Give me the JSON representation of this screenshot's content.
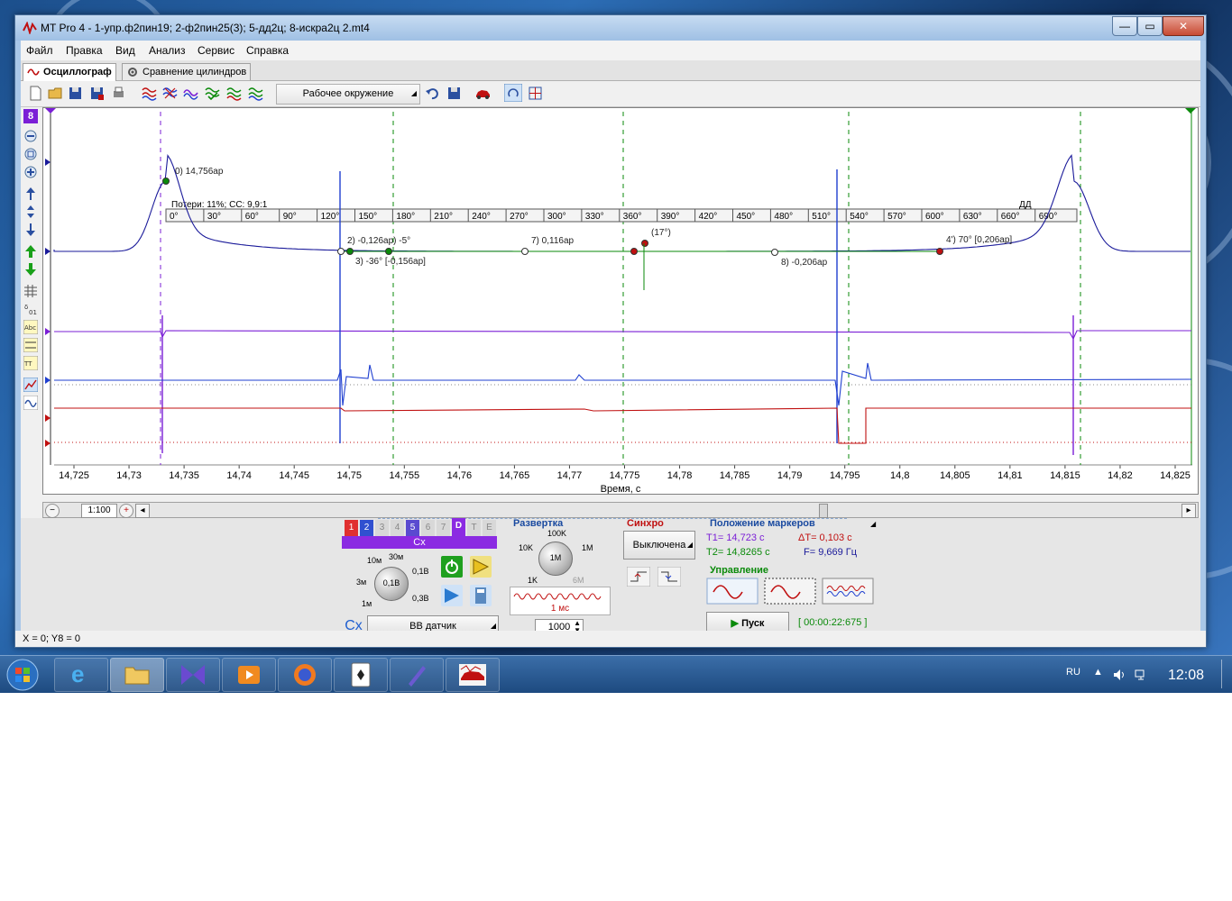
{
  "window": {
    "title": "MT Pro 4 - 1-упр.ф2пин19; 2-ф2пин25(3); 5-дд2ц; 8-искра2ц 2.mt4"
  },
  "menu": [
    "Файл",
    "Правка",
    "Вид",
    "Анализ",
    "Сервис",
    "Справка"
  ],
  "tabs": [
    {
      "label": "Осциллограф",
      "active": true
    },
    {
      "label": "Сравнение цилиндров",
      "active": false
    }
  ],
  "toolbar": {
    "environment_label": "Рабочее окружение"
  },
  "left_tools": {
    "channel_badge": "8"
  },
  "scope": {
    "xlabel": "Время, с",
    "x_ticks": [
      "14,725",
      "14,73",
      "14,735",
      "14,74",
      "14,745",
      "14,75",
      "14,755",
      "14,76",
      "14,765",
      "14,77",
      "14,775",
      "14,78",
      "14,785",
      "14,79",
      "14,795",
      "14,8",
      "14,805",
      "14,81",
      "14,815",
      "14,82",
      "14,825"
    ],
    "angle_ticks": [
      "0°",
      "30°",
      "60°",
      "90°",
      "120°",
      "150°",
      "180°",
      "210°",
      "240°",
      "270°",
      "300°",
      "330°",
      "360°",
      "390°",
      "420°",
      "450°",
      "480°",
      "510°",
      "540°",
      "570°",
      "600°",
      "630°",
      "660°",
      "690°"
    ],
    "angle_label": "ДД",
    "losses_label": "Потери: 11%; СС: 9,9:1",
    "markers": [
      {
        "label": "0)  14,756ар"
      },
      {
        "label": "2)  -0,126ар)  -5°"
      },
      {
        "label": "3)  -36° [-0,156ар]"
      },
      {
        "label": "7)  0,116ар"
      },
      {
        "label": "(17°)"
      },
      {
        "label": "8)  -0,206ар"
      },
      {
        "label": "4')  70° [0,206ар]"
      }
    ]
  },
  "scrollbar": {
    "zoom": "1:100"
  },
  "channels": {
    "tabs": [
      "1",
      "2",
      "3",
      "4",
      "5",
      "6",
      "7",
      "D",
      "T",
      "E"
    ],
    "header": "Cx",
    "knob_labels": [
      "10м",
      "30м",
      "3м",
      "0,1В",
      "1м",
      "0,3В"
    ],
    "knob_value": "0,1В",
    "sensor_prefix": "Cx",
    "sensor_label": "ВВ датчик"
  },
  "sweep": {
    "title": "Развертка",
    "knob_labels": [
      "100K",
      "10K",
      "1M",
      "1K",
      "6M"
    ],
    "knob_value": "1M",
    "time_label": "1 мс",
    "points": "1000"
  },
  "sync": {
    "title": "Синхро",
    "mode": "Выключена"
  },
  "markers_pos": {
    "title": "Положение маркеров",
    "t1": "T1= 14,723 с",
    "dt": "ΔT= 0,103 с",
    "t2": "T2= 14,8265 с",
    "f": "F= 9,669 Гц"
  },
  "control": {
    "title": "Управление",
    "start_label": "Пуск",
    "timer": "[ 00:00:22:675 ]"
  },
  "status": {
    "coords": "X = 0; Y8 = 0"
  },
  "tray": {
    "lang": "RU",
    "time": "12:08"
  },
  "colors": {
    "purple": "#7b1fd6",
    "blue": "#1f3fd0",
    "red": "#c01010",
    "navy": "#1a1a9a",
    "green": "#0a8a0a"
  }
}
